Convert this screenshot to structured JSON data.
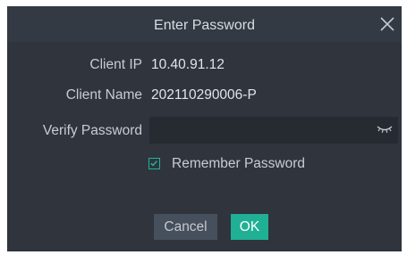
{
  "dialog": {
    "title": "Enter Password",
    "client_ip_label": "Client IP",
    "client_ip_value": "10.40.91.12",
    "client_name_label": "Client Name",
    "client_name_value": "202110290006-P",
    "verify_password_label": "Verify Password",
    "verify_password_value": "",
    "remember_password_label": "Remember Password",
    "remember_password_checked": true,
    "cancel_label": "Cancel",
    "ok_label": "OK"
  },
  "icons": {
    "close": "close-icon",
    "password_visibility": "eye-closed-icon",
    "checkbox": "checkmark-icon"
  },
  "colors": {
    "dialog_bg": "#2f343d",
    "titlebar_bg": "#333a44",
    "input_bg": "#262b32",
    "accent": "#20b095",
    "cancel_bg": "#464f5c"
  }
}
